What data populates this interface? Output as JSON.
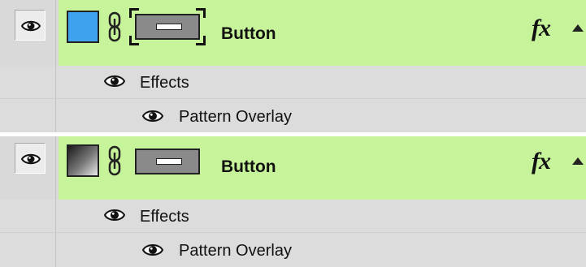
{
  "panels": [
    {
      "layer": {
        "name": "Button",
        "fx_label": "fx",
        "swatch_color": "#3ea2ee",
        "swatch_style": "solid-blue",
        "mask_selected": true,
        "visible_icon": "eye-icon",
        "chain_icon": "chain-link-icon",
        "scroll_icon": "scroll-up-arrow-icon"
      },
      "effects_label": "Effects",
      "effect_items": [
        "Pattern Overlay"
      ]
    },
    {
      "layer": {
        "name": "Button",
        "fx_label": "fx",
        "swatch_style": "black-to-white-gradient",
        "mask_selected": false,
        "visible_icon": "eye-icon",
        "chain_icon": "chain-link-icon",
        "scroll_icon": "scroll-up-arrow-icon"
      },
      "effects_label": "Effects",
      "effect_items": [
        "Pattern Overlay"
      ]
    }
  ],
  "colors": {
    "selected_layer_bg": "#c7f49a",
    "row_bg": "#d9d9d9",
    "blue_swatch": "#3ea2ee"
  }
}
